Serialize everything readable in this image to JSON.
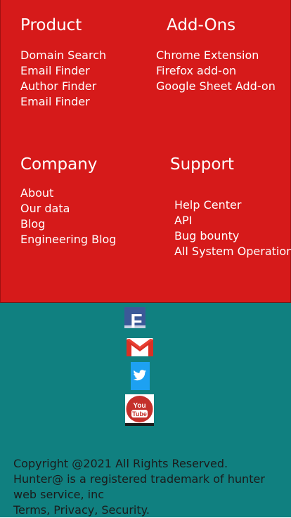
{
  "footer": {
    "product": {
      "heading": "Product",
      "links": [
        "Domain Search",
        "Email Finder",
        "Author Finder",
        "Email Finder"
      ]
    },
    "addons": {
      "heading": "Add-Ons",
      "links": [
        "Chrome Extension",
        "Firefox add-on",
        "Google Sheet Add-on"
      ]
    },
    "company": {
      "heading": "Company",
      "links": [
        "About",
        "Our data",
        "Blog",
        "Engineering Blog"
      ]
    },
    "support": {
      "heading": "Support",
      "links": [
        "Help Center",
        "API",
        "Bug bounty",
        "All System Operation"
      ]
    }
  },
  "social": {
    "facebook": "F",
    "youtube_top": "You",
    "youtube_bottom": "Tube"
  },
  "copyright": {
    "line1": "Copyright @2021 All Rights Reserved. Hunter@ is a registered trademark of hunter web service, inc",
    "line2": "Terms, Privacy, Security."
  },
  "colors": {
    "footer_top": "#d61a1a",
    "footer_bottom": "#108080",
    "facebook": "#3b5998",
    "twitter": "#1da1f2",
    "youtube": "#c4302b",
    "gmail": "#d93025"
  },
  "icons": [
    "facebook-icon",
    "gmail-icon",
    "twitter-icon",
    "youtube-icon"
  ]
}
